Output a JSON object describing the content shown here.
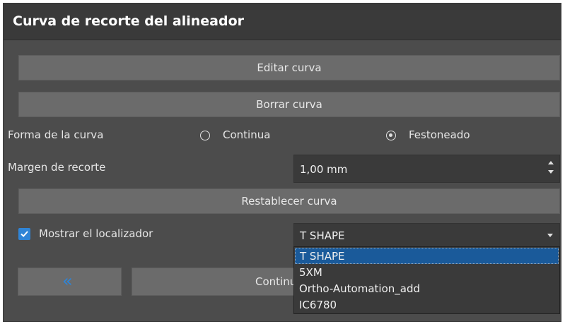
{
  "panel": {
    "title": "Curva de recorte del alineador"
  },
  "buttons": {
    "edit_curve": "Editar curva",
    "delete_curve": "Borrar curva",
    "reset_curve": "Restablecer curva",
    "back_icon": "double-chevron-left-icon",
    "continue": "Continuar"
  },
  "curve_shape": {
    "label": "Forma de la curva",
    "options": [
      {
        "label": "Continua",
        "checked": false
      },
      {
        "label": "Festoneado",
        "checked": true
      }
    ]
  },
  "margin": {
    "label": "Margen de recorte",
    "value": "1,00 mm"
  },
  "locator": {
    "checkbox_label": "Mostrar el localizador",
    "checked": true,
    "selected": "T SHAPE",
    "options": [
      "T SHAPE",
      "5XM",
      "Ortho-Automation_add",
      "IC6780"
    ]
  },
  "colors": {
    "panel_bg": "#4c4c4c",
    "titlebar_bg": "#3a3a3a",
    "button_bg": "#6b6b6b",
    "accent": "#2f84d6",
    "selected_option_bg": "#1a5a9a"
  }
}
